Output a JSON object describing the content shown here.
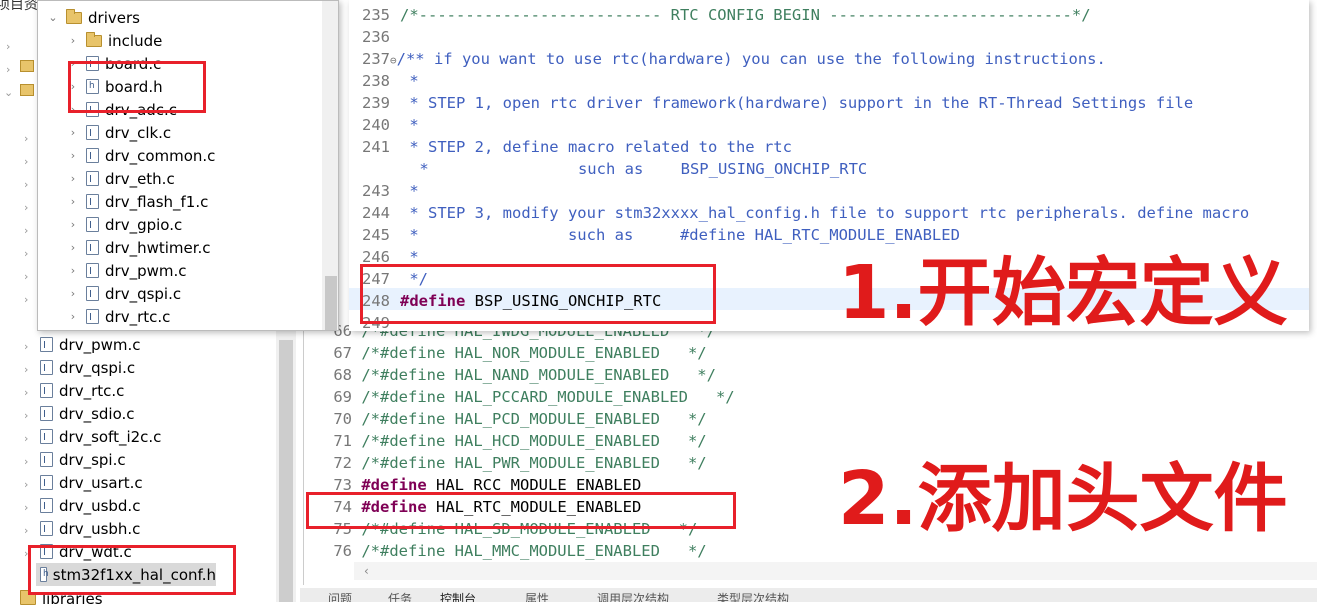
{
  "back_tree": {
    "top_label": "项目资",
    "files": [
      "drv_pwm.c",
      "drv_qspi.c",
      "drv_rtc.c",
      "drv_sdio.c",
      "drv_soft_i2c.c",
      "drv_spi.c",
      "drv_usart.c",
      "drv_usbd.c",
      "drv_usbh.c",
      "drv_wdt.c",
      "stm32f1xx_hal_conf.h"
    ],
    "bottom_folder": "libraries"
  },
  "popup_tree": {
    "folder": "drivers",
    "subfolder": "include",
    "files": [
      "board.c",
      "board.h",
      "drv_adc.c",
      "drv_clk.c",
      "drv_common.c",
      "drv_eth.c",
      "drv_flash_f1.c",
      "drv_gpio.c",
      "drv_hwtimer.c",
      "drv_pwm.c",
      "drv_qspi.c",
      "drv_rtc.c"
    ]
  },
  "top_code": [
    {
      "ln": "235",
      "text": "/*-------------------------- RTC CONFIG BEGIN --------------------------*/",
      "style": "cm"
    },
    {
      "ln": "236",
      "text": "",
      "style": "cm"
    },
    {
      "ln": "237",
      "fold": "⊖",
      "text": "/** if you want to use rtc(hardware) you can use the following instructions.",
      "style": "cmdoc"
    },
    {
      "ln": "238",
      "text": " *",
      "style": "cmdoc"
    },
    {
      "ln": "239",
      "text": " * STEP 1, open rtc driver framework(hardware) support in the RT-Thread Settings file",
      "style": "cmdoc"
    },
    {
      "ln": "240",
      "text": " *",
      "style": "cmdoc"
    },
    {
      "ln": "241",
      "text": " * STEP 2, define macro related to the rtc",
      "style": "cmdoc"
    },
    {
      "ln": "",
      "text": " *                such as    BSP_USING_ONCHIP_RTC",
      "style": "cmdoc"
    },
    {
      "ln": "243",
      "text": " *",
      "style": "cmdoc"
    },
    {
      "ln": "244",
      "text": " * STEP 3, modify your stm32xxxx_hal_config.h file to support rtc peripherals. define macro",
      "style": "cmdoc"
    },
    {
      "ln": "245",
      "text": " *                such as     #define HAL_RTC_MODULE_ENABLED",
      "style": "cmdoc"
    },
    {
      "ln": "246",
      "text": " *",
      "style": "cmdoc"
    },
    {
      "ln": "247",
      "text": " */",
      "style": "cmdoc"
    },
    {
      "ln": "248",
      "kw": "#define",
      "text": " BSP_USING_ONCHIP_RTC",
      "style": "plain"
    },
    {
      "ln": "249",
      "text": "",
      "style": "cm"
    }
  ],
  "bottom_code": [
    {
      "ln": "66",
      "text": "/*#define HAL_IWDG_MODULE_ENABLED   */",
      "style": "cm"
    },
    {
      "ln": "67",
      "text": "/*#define HAL_NOR_MODULE_ENABLED   */",
      "style": "cm"
    },
    {
      "ln": "68",
      "text": "/*#define HAL_NAND_MODULE_ENABLED   */",
      "style": "cm"
    },
    {
      "ln": "69",
      "text": "/*#define HAL_PCCARD_MODULE_ENABLED   */",
      "style": "cm"
    },
    {
      "ln": "70",
      "text": "/*#define HAL_PCD_MODULE_ENABLED   */",
      "style": "cm"
    },
    {
      "ln": "71",
      "text": "/*#define HAL_HCD_MODULE_ENABLED   */",
      "style": "cm"
    },
    {
      "ln": "72",
      "text": "/*#define HAL_PWR_MODULE_ENABLED   */",
      "style": "cm"
    },
    {
      "ln": "73",
      "kw": "#define",
      "text": " HAL_RCC_MODULE_ENABLED",
      "style": "plain"
    },
    {
      "ln": "74",
      "kw": "#define",
      "text": " HAL_RTC_MODULE_ENABLED",
      "style": "plain"
    },
    {
      "ln": "75",
      "text": "/*#define HAL_SD_MODULE_ENABLED   */",
      "style": "cm"
    },
    {
      "ln": "76",
      "text": "/*#define HAL_MMC_MODULE_ENABLED   */",
      "style": "cm"
    }
  ],
  "annotations": {
    "step1": "1.开始宏定义",
    "step2": "2.添加头文件"
  },
  "bottom_tabs": [
    "问题",
    "任务",
    "控制台",
    "属性",
    "调用层次结构",
    "类型层次结构"
  ],
  "colors": {
    "annotation": "#e01b1b",
    "comment": "#3f7f5f",
    "keyword": "#7f0055",
    "doc": "#3f5fbf"
  }
}
